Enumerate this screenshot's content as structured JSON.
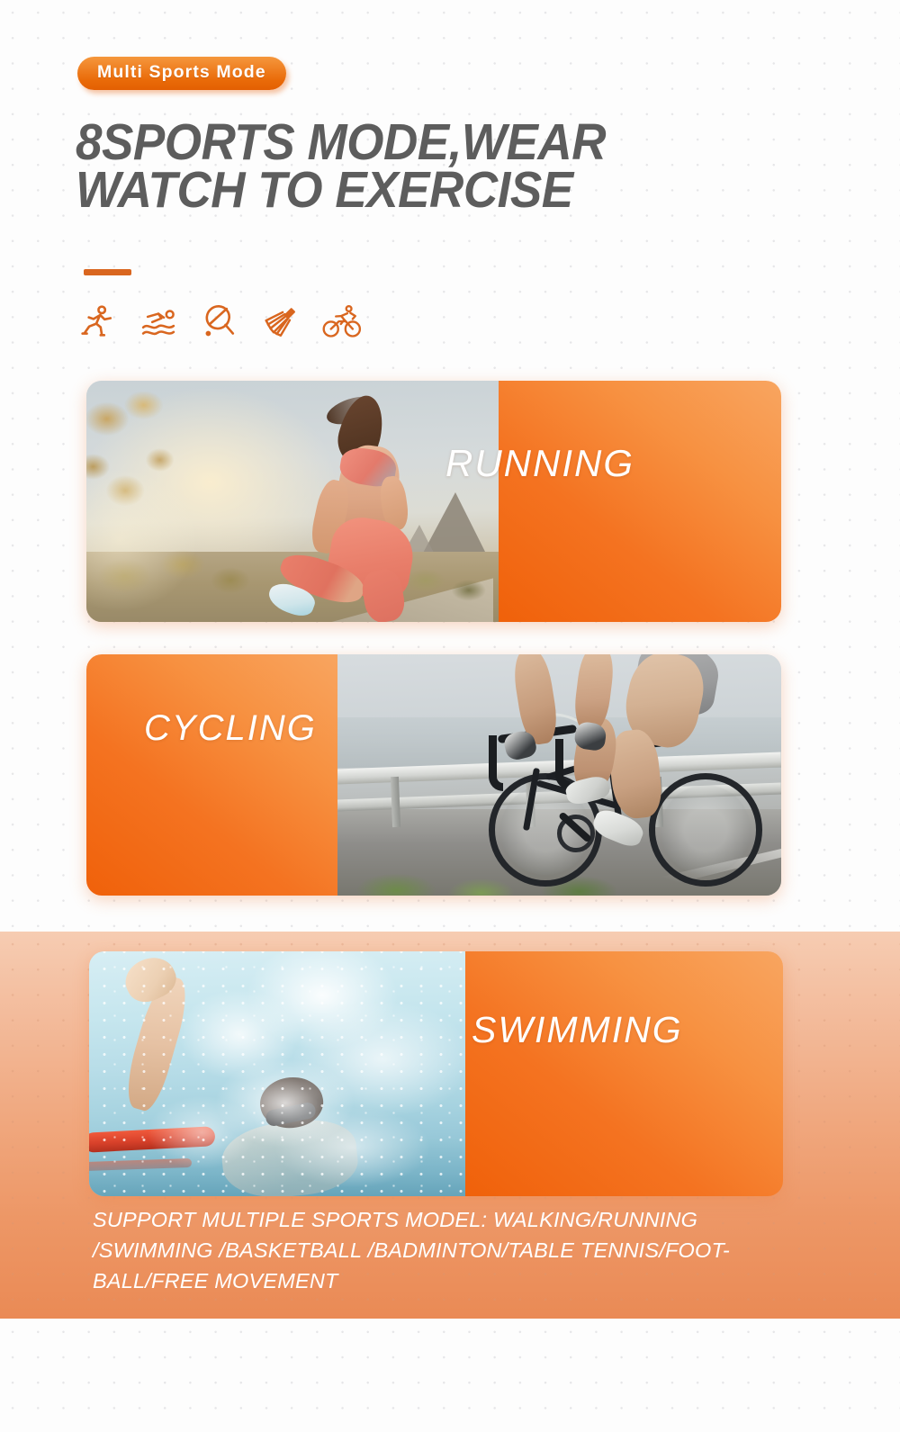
{
  "badge": {
    "label": "Multi Sports Mode"
  },
  "headline": {
    "text": "8SPORTS MODE,WEAR\nWATCH TO EXERCISE"
  },
  "icons": [
    {
      "name": "running-icon",
      "label": "Running"
    },
    {
      "name": "swimming-icon",
      "label": "Swimming"
    },
    {
      "name": "table-tennis-icon",
      "label": "Table Tennis"
    },
    {
      "name": "badminton-icon",
      "label": "Badminton"
    },
    {
      "name": "cycling-icon",
      "label": "Cycling"
    }
  ],
  "cards": [
    {
      "label": "RUNNING",
      "image_alt": "Woman running on a mountain road at sunrise"
    },
    {
      "label": "CYCLING",
      "image_alt": "Cyclist riding a road bike along a guardrail"
    },
    {
      "label": "SWIMMING",
      "image_alt": "Swimmer doing freestyle stroke in a pool lane"
    }
  ],
  "caption": {
    "text": "SUPPORT MULTIPLE SPORTS MODEL: WALKING/RUNNING /SWIMMING /BASKETBALL /BADMINTON/TABLE TENNIS/FOOT-BALL/FREE MOVEMENT"
  },
  "colors": {
    "accent_orange": "#ea6e1e",
    "badge_top": "#f5973c",
    "badge_bottom": "#e35f02",
    "card_orange_dark": "#f0610a",
    "card_orange_light": "#f8a560",
    "band_top": "#f6ccb2",
    "band_bottom": "#ea8a55",
    "heading_gray": "#5d5d5d",
    "divider": "#d9661f"
  }
}
